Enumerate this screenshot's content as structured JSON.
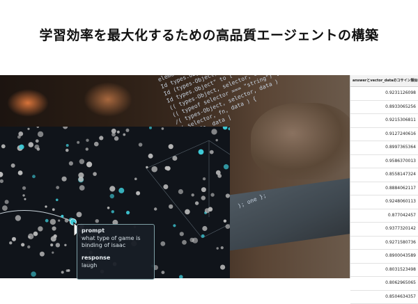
{
  "title": "学習効率を最大化するための高品質エージェントの構築",
  "code_lines": [
    "     elements\"focus\");",
    "  Id types.Object = []",
    "  Id (types-Object) handlers",
    "  Id types.Object\" to [",
    "  (( types-Object, selector, data )",
    "  (( typeof selector === \"string\") {",
    "  /( types-Object, selector, data )",
    "  /( selector, fn, data ) {",
    "  type, fn, data |"
  ],
  "code_tail": "); one };",
  "tooltip": {
    "prompt_label": "prompt",
    "prompt_text": "what type of game is binding of isaac",
    "response_label": "response",
    "response_text": "laugh"
  },
  "table": {
    "header": "answerとvector_dataのコサイン類似値",
    "values": [
      "0.9231126098",
      "0.8933065256",
      "0.9215306811",
      "0.9127240616",
      "0.8997365364",
      "0.9586370013",
      "0.8558147324",
      "0.8884062117",
      "0.9248060113",
      "0.877042457",
      "0.9377320142",
      "0.9271580736",
      "0.8900043589",
      "0.8031523498",
      "0.8062965065",
      "0.8504634357"
    ]
  },
  "colors": {
    "point_gray": "#bdbdbd",
    "point_cyan": "#3ec9d6",
    "viz_bg": "#10141a"
  }
}
